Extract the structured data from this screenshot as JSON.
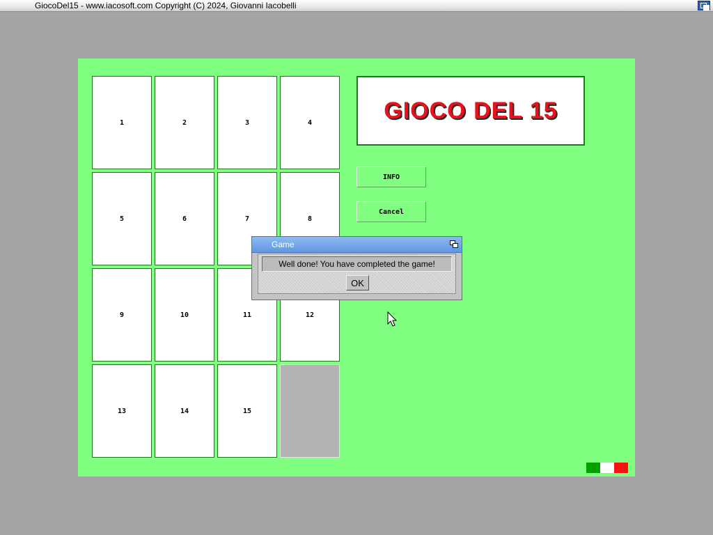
{
  "window": {
    "title": "GiocoDel15 - www.iacosoft.com Copyright (C) 2024, Giovanni Iacobelli",
    "depth_gadget_icon": "depth-icon"
  },
  "colors": {
    "screen_bg": "#a5a5a5",
    "panel_bg": "#80ff80",
    "tile_bg": "#ffffff",
    "empty_tile_bg": "#b4b4b4",
    "logo_red": "#e8121c",
    "flag": [
      "#00a000",
      "#ffffff",
      "#ff1010"
    ]
  },
  "board": {
    "rows": [
      [
        "1",
        "2",
        "3",
        "4"
      ],
      [
        "5",
        "6",
        "7",
        "8"
      ],
      [
        "9",
        "10",
        "11",
        "12"
      ],
      [
        "13",
        "14",
        "15",
        ""
      ]
    ]
  },
  "logo": {
    "text": "GIOCO DEL 15"
  },
  "buttons": {
    "info": "INFO",
    "cancel": "Cancel"
  },
  "dialog": {
    "title": "Game",
    "message": "Well done! You have completed the game!",
    "ok": "OK",
    "depth_icon": "depth-icon"
  },
  "flag_icon": "italian-flag-icon"
}
